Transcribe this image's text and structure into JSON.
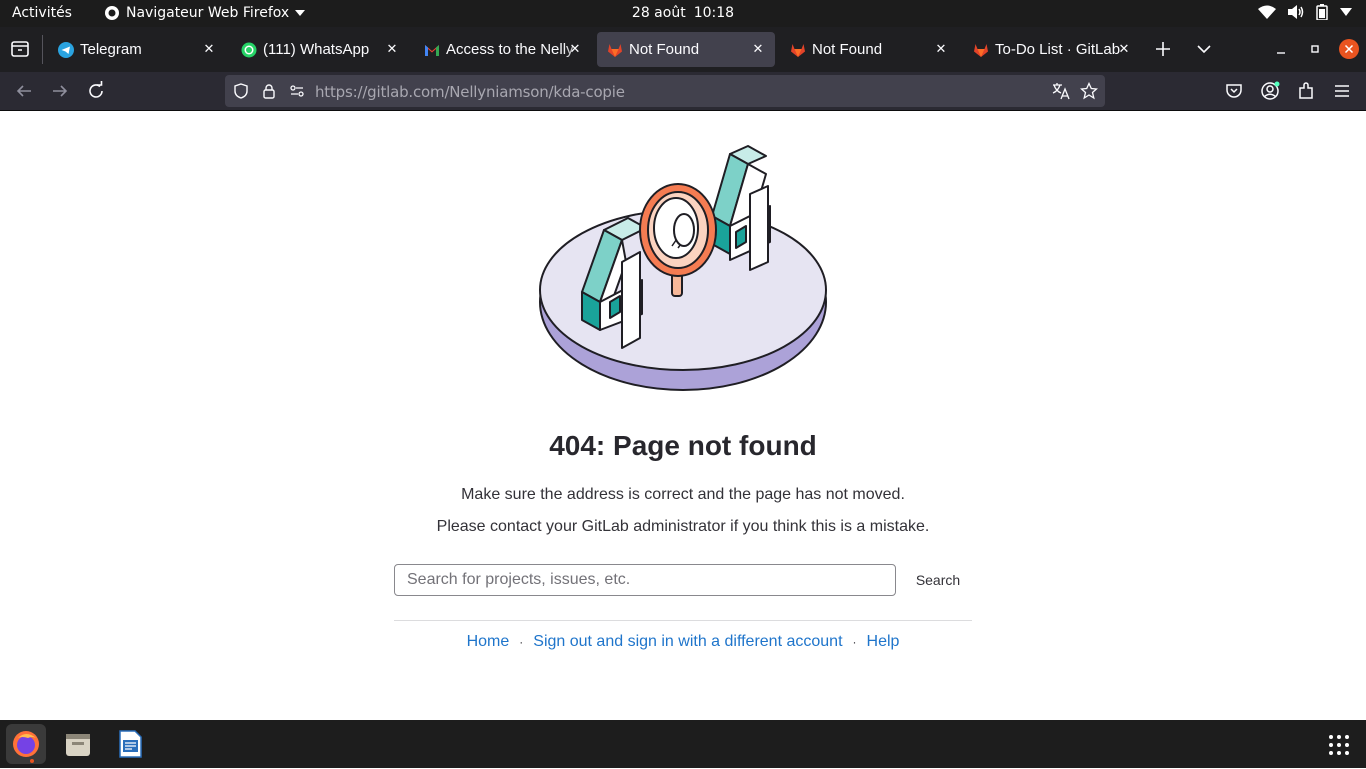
{
  "topbar": {
    "activities": "Activités",
    "app_menu": "Navigateur Web Firefox",
    "date": "28 août",
    "time": "10:18"
  },
  "tabs": [
    {
      "title": "Telegram",
      "icon": "telegram-icon",
      "active": false
    },
    {
      "title": "(111) WhatsApp",
      "icon": "whatsapp-icon",
      "active": false
    },
    {
      "title": "Access to the Nelly",
      "icon": "gmail-icon",
      "active": false
    },
    {
      "title": "Not Found",
      "icon": "gitlab-icon",
      "active": true
    },
    {
      "title": "Not Found",
      "icon": "gitlab-icon",
      "active": false
    },
    {
      "title": "To-Do List · GitLab",
      "icon": "gitlab-icon",
      "active": false
    }
  ],
  "navbar": {
    "url_host": "https://gitlab.com",
    "url_path": "/Nellyniamson/kda-copie"
  },
  "page": {
    "title": "404: Page not found",
    "line1": "Make sure the address is correct and the page has not moved.",
    "line2": "Please contact your GitLab administrator if you think this is a mistake.",
    "search_placeholder": "Search for projects, issues, etc.",
    "search_button": "Search",
    "links": {
      "home": "Home",
      "sign_out": "Sign out and sign in with a different account",
      "help": "Help"
    }
  },
  "colors": {
    "link": "#1f75cb",
    "gitlab_orange": "#e24329",
    "active_tab": "#42414d"
  }
}
